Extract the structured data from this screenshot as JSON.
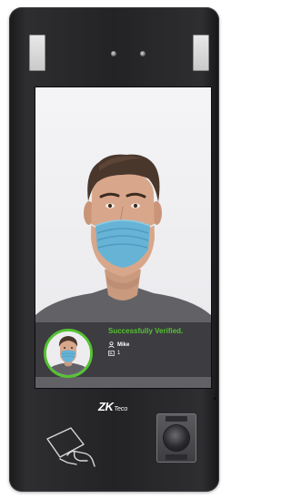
{
  "screen": {
    "status_message": "Successfully Verified.",
    "user_name": "Mike",
    "user_id": "1",
    "status_color": "#55c232"
  },
  "device": {
    "brand_main": "ZK",
    "brand_sub": "Teco"
  },
  "icons": {
    "user": "user-icon",
    "id_card": "id-card-icon",
    "rfid_card": "rfid-card-icon",
    "fingerprint": "fingerprint-sensor-icon"
  }
}
